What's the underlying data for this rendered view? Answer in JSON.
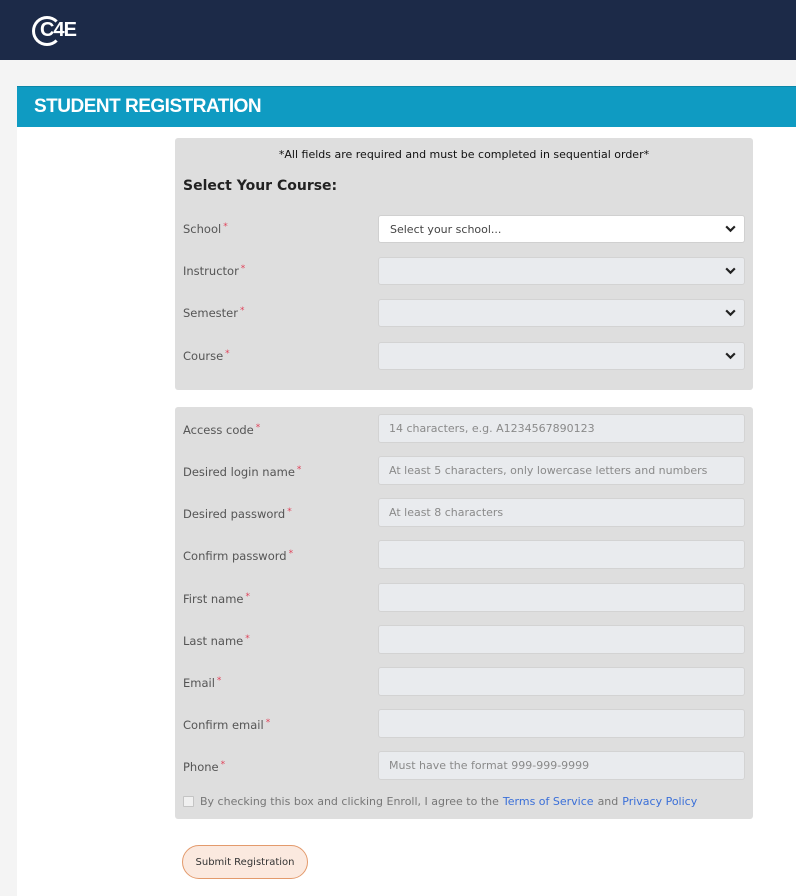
{
  "header": {
    "logo_text": "C4E"
  },
  "banner": {
    "title": "STUDENT REGISTRATION"
  },
  "course_section": {
    "notice": "*All fields are required and must be completed in sequential order*",
    "title": "Select Your Course:",
    "fields": [
      {
        "label": "School",
        "value": "Select your school..."
      },
      {
        "label": "Instructor",
        "value": ""
      },
      {
        "label": "Semester",
        "value": ""
      },
      {
        "label": "Course",
        "value": ""
      }
    ]
  },
  "account_section": {
    "fields": [
      {
        "label": "Access code",
        "placeholder": "14 characters, e.g. A1234567890123"
      },
      {
        "label": "Desired login name",
        "placeholder": "At least 5 characters, only lowercase letters and numbers"
      },
      {
        "label": "Desired password",
        "placeholder": "At least 8 characters"
      },
      {
        "label": "Confirm password",
        "placeholder": ""
      },
      {
        "label": "First name",
        "placeholder": ""
      },
      {
        "label": "Last name",
        "placeholder": ""
      },
      {
        "label": "Email",
        "placeholder": ""
      },
      {
        "label": "Confirm email",
        "placeholder": ""
      },
      {
        "label": "Phone",
        "placeholder": "Must have the format 999-999-9999"
      }
    ],
    "agree_text": "By checking this box and clicking Enroll, I agree to the",
    "terms_link": "Terms of Service",
    "and_text": "and",
    "privacy_link": "Privacy Policy"
  },
  "required_mark": "*",
  "submit_label": "Submit Registration",
  "colors": {
    "topbar": "#1c2a48",
    "banner": "#0f9bc2",
    "panel": "#dedede",
    "required": "#e0435a",
    "link": "#3a6fd8",
    "submit_border": "#e39a6c"
  }
}
